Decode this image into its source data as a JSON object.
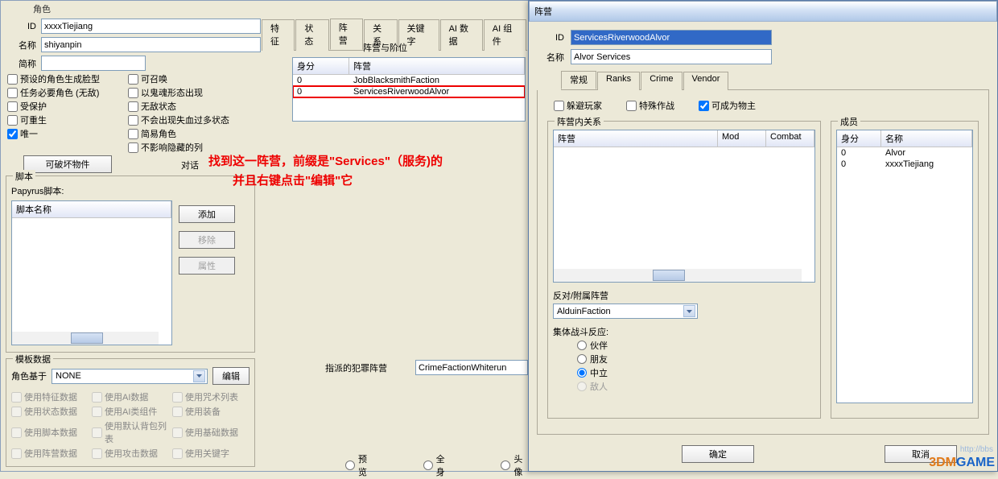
{
  "left": {
    "window_title": "角色",
    "labels": {
      "id": "ID",
      "name": "名称",
      "nick": "简称"
    },
    "values": {
      "id": "xxxxTiejiang",
      "name": "shiyanpin",
      "nick": ""
    },
    "destructible_btn": "可破坏物件",
    "dialog_label": "对话",
    "checks_col1": [
      "预设的角色生成脸型",
      "任务必要角色 (无敌)",
      "受保护",
      "可重生",
      "唯一"
    ],
    "checks_col1_state": [
      false,
      false,
      false,
      false,
      true
    ],
    "checks_col2": [
      "可召唤",
      "以鬼魂形态出现",
      "无敌状态",
      "不会出现失血过多状态",
      "简易角色",
      "不影响隐藏的列"
    ],
    "checks_col2_state": [
      false,
      false,
      false,
      false,
      false,
      false
    ],
    "scripts_group": "脚本",
    "papyrus_label": "Papyrus脚本:",
    "script_name_col": "脚本名称",
    "btn_add": "添加",
    "btn_remove": "移除",
    "btn_prop": "属性",
    "templates_group": "模板数据",
    "based_on": "角色基于",
    "based_value": "NONE",
    "btn_edit": "编辑",
    "tmpl_checks": [
      [
        "使用特征数据",
        "使用AI数据",
        "使用咒术列表"
      ],
      [
        "使用状态数据",
        "使用AI类组件",
        "使用装备"
      ],
      [
        "使用脚本数据",
        "使用默认背包列表",
        "使用基础数据"
      ],
      [
        "使用阵营数据",
        "使用攻击数据",
        "使用关键字"
      ]
    ]
  },
  "mid": {
    "tabs": [
      "特征",
      "状态",
      "阵营",
      "关系",
      "关键字",
      "AI 数据",
      "AI 组件"
    ],
    "active_tab": 2,
    "faction_header": "阵营与阶位",
    "list_cols": [
      "身分",
      "阵营"
    ],
    "list_rows": [
      {
        "rank": "0",
        "faction": "JobBlacksmithFaction",
        "hl": false
      },
      {
        "rank": "0",
        "faction": "ServicesRiverwoodAlvor",
        "hl": true
      }
    ],
    "annotation_l1": "找到这一阵营，前缀是\"Services\"（服务)的",
    "annotation_l2": "并且右键点击\"编辑\"它",
    "crime_label": "指派的犯罪阵营",
    "crime_value": "CrimeFactionWhiterun",
    "bottom_tabs": [
      "预览",
      "全身",
      "头像"
    ]
  },
  "right": {
    "title": "阵营",
    "labels": {
      "id": "ID",
      "name": "名称"
    },
    "values": {
      "id": "ServicesRiverwoodAlvor",
      "name": "Alvor Services"
    },
    "tabs": [
      "常规",
      "Ranks",
      "Crime",
      "Vendor"
    ],
    "check_hide": "躲避玩家",
    "check_special": "特殊作战",
    "check_owner": "可成为物主",
    "check_owner_state": true,
    "relations_group": "阵营内关系",
    "rel_cols": [
      "阵营",
      "Mod",
      "Combat"
    ],
    "opposite_label": "反对/附属阵营",
    "opposite_value": "AlduinFaction",
    "group_reaction": "集体战斗反应:",
    "radios": [
      "伙伴",
      "朋友",
      "中立",
      "敌人"
    ],
    "radio_selected": 2,
    "members_group": "成员",
    "mem_cols": [
      "身分",
      "名称"
    ],
    "mem_rows": [
      {
        "rank": "0",
        "name": "Alvor"
      },
      {
        "rank": "0",
        "name": "xxxxTiejiang"
      }
    ],
    "btn_ok": "确定",
    "btn_cancel": "取消"
  },
  "watermark": {
    "url": "http://bbs",
    "text": "3DMGAME"
  }
}
